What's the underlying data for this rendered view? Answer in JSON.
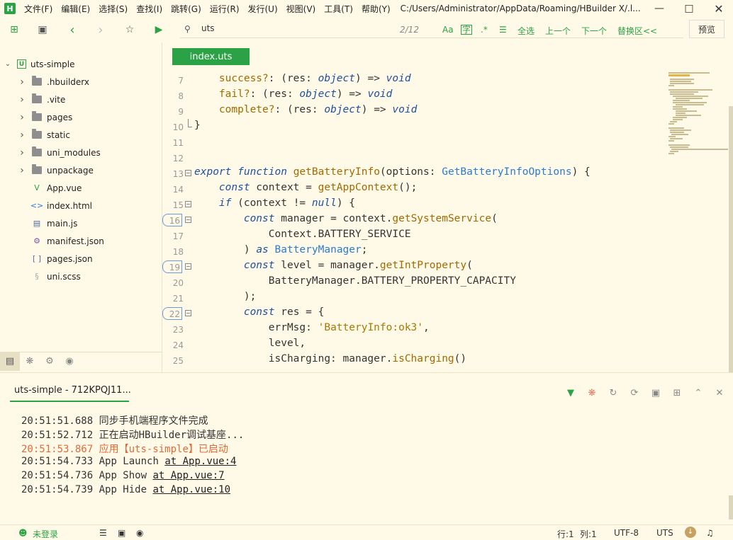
{
  "menubar": {
    "logo": "H",
    "items": [
      "文件(F)",
      "编辑(E)",
      "选择(S)",
      "查找(I)",
      "跳转(G)",
      "运行(R)",
      "发行(U)",
      "视图(V)",
      "工具(T)",
      "帮助(Y)"
    ],
    "path": "C:/Users/Administrator/AppData/Roaming/HBuilder X/.l..."
  },
  "toolbar": {
    "search_value": "uts",
    "match_count": "2/12",
    "select_all": "全选",
    "prev": "上一个",
    "next": "下一个",
    "replace": "替换区<<",
    "preview": "预览",
    "case_label": "Aa",
    "word_label": "字",
    "regex_label": ".*"
  },
  "sidebar": {
    "project": "uts-simple",
    "items": [
      {
        "label": ".hbuilderx",
        "type": "folder"
      },
      {
        "label": ".vite",
        "type": "folder"
      },
      {
        "label": "pages",
        "type": "folder"
      },
      {
        "label": "static",
        "type": "folder"
      },
      {
        "label": "uni_modules",
        "type": "folder"
      },
      {
        "label": "unpackage",
        "type": "folder"
      },
      {
        "label": "App.vue",
        "type": "vue",
        "icon": "V"
      },
      {
        "label": "index.html",
        "type": "html",
        "icon": "<>"
      },
      {
        "label": "main.js",
        "type": "js",
        "icon": "▤"
      },
      {
        "label": "manifest.json",
        "type": "json",
        "icon": "⚙"
      },
      {
        "label": "pages.json",
        "type": "json",
        "icon": "[ ]"
      },
      {
        "label": "uni.scss",
        "type": "scss",
        "icon": "§"
      }
    ]
  },
  "editor": {
    "tab": "index.uts",
    "lines": [
      {
        "n": "7",
        "fold": false,
        "boxed": false,
        "segs": [
          [
            "pl",
            "    "
          ],
          [
            "pr",
            "success?"
          ],
          [
            "pl",
            ": (res: "
          ],
          [
            "kw",
            "object"
          ],
          [
            "pl",
            ") "
          ],
          [
            "pl",
            "=> "
          ],
          [
            "kw",
            "void"
          ]
        ]
      },
      {
        "n": "8",
        "fold": false,
        "boxed": false,
        "segs": [
          [
            "pl",
            "    "
          ],
          [
            "pr",
            "fail?"
          ],
          [
            "pl",
            ": (res: "
          ],
          [
            "kw",
            "object"
          ],
          [
            "pl",
            ") => "
          ],
          [
            "kw",
            "void"
          ]
        ]
      },
      {
        "n": "9",
        "fold": false,
        "boxed": false,
        "segs": [
          [
            "pl",
            "    "
          ],
          [
            "pr",
            "complete?"
          ],
          [
            "pl",
            ": (res: "
          ],
          [
            "kw",
            "object"
          ],
          [
            "pl",
            ") => "
          ],
          [
            "kw",
            "void"
          ]
        ]
      },
      {
        "n": "10",
        "fold": false,
        "boxed": false,
        "segs": [
          [
            "pl",
            "}"
          ]
        ]
      },
      {
        "n": "11",
        "fold": false,
        "boxed": false,
        "segs": [
          [
            "pl",
            ""
          ]
        ]
      },
      {
        "n": "12",
        "fold": false,
        "boxed": false,
        "segs": [
          [
            "pl",
            ""
          ]
        ]
      },
      {
        "n": "13",
        "fold": true,
        "boxed": false,
        "segs": [
          [
            "kw",
            "export"
          ],
          [
            "pl",
            " "
          ],
          [
            "kw",
            "function"
          ],
          [
            "pl",
            " "
          ],
          [
            "fn",
            "getBatteryInfo"
          ],
          [
            "pl",
            "(options: "
          ],
          [
            "ty",
            "GetBatteryInfoOptions"
          ],
          [
            "pl",
            ") {"
          ]
        ]
      },
      {
        "n": "14",
        "fold": false,
        "boxed": false,
        "segs": [
          [
            "pl",
            "    "
          ],
          [
            "kw",
            "const"
          ],
          [
            "pl",
            " context = "
          ],
          [
            "fn",
            "getAppContext"
          ],
          [
            "pl",
            "();"
          ]
        ]
      },
      {
        "n": "15",
        "fold": true,
        "boxed": false,
        "segs": [
          [
            "pl",
            "    "
          ],
          [
            "kw",
            "if"
          ],
          [
            "pl",
            " (context != "
          ],
          [
            "kw",
            "null"
          ],
          [
            "pl",
            ") {"
          ]
        ]
      },
      {
        "n": "16",
        "fold": true,
        "boxed": true,
        "segs": [
          [
            "pl",
            "        "
          ],
          [
            "kw",
            "const"
          ],
          [
            "pl",
            " manager = context."
          ],
          [
            "fn",
            "getSystemService"
          ],
          [
            "pl",
            "("
          ]
        ]
      },
      {
        "n": "17",
        "fold": false,
        "boxed": false,
        "segs": [
          [
            "pl",
            "            Context.BATTERY_SERVICE"
          ]
        ]
      },
      {
        "n": "18",
        "fold": false,
        "boxed": false,
        "segs": [
          [
            "pl",
            "        ) "
          ],
          [
            "kw",
            "as"
          ],
          [
            "pl",
            " "
          ],
          [
            "ty",
            "BatteryManager"
          ],
          [
            "pl",
            ";"
          ]
        ]
      },
      {
        "n": "19",
        "fold": true,
        "boxed": true,
        "segs": [
          [
            "pl",
            "        "
          ],
          [
            "kw",
            "const"
          ],
          [
            "pl",
            " level = manager."
          ],
          [
            "fn",
            "getIntProperty"
          ],
          [
            "pl",
            "("
          ]
        ]
      },
      {
        "n": "20",
        "fold": false,
        "boxed": false,
        "segs": [
          [
            "pl",
            "            BatteryManager.BATTERY_PROPERTY_CAPACITY"
          ]
        ]
      },
      {
        "n": "21",
        "fold": false,
        "boxed": false,
        "segs": [
          [
            "pl",
            "        );"
          ]
        ]
      },
      {
        "n": "22",
        "fold": true,
        "boxed": true,
        "segs": [
          [
            "pl",
            "        "
          ],
          [
            "kw",
            "const"
          ],
          [
            "pl",
            " res = {"
          ]
        ]
      },
      {
        "n": "23",
        "fold": false,
        "boxed": false,
        "segs": [
          [
            "pl",
            "            errMsg: "
          ],
          [
            "str",
            "'BatteryInfo:ok3'"
          ],
          [
            "pl",
            ","
          ]
        ]
      },
      {
        "n": "24",
        "fold": false,
        "boxed": false,
        "segs": [
          [
            "pl",
            "            level,"
          ]
        ]
      },
      {
        "n": "25",
        "fold": false,
        "boxed": false,
        "segs": [
          [
            "pl",
            "            isCharging: manager."
          ],
          [
            "fn",
            "isCharging"
          ],
          [
            "pl",
            "()"
          ]
        ]
      }
    ]
  },
  "console": {
    "tab": "uts-simple - 712KPQJ11...",
    "logs": [
      {
        "time": "20:51:51.688",
        "msg": "同步手机端程序文件完成",
        "warn": false,
        "link": ""
      },
      {
        "time": "20:51:52.712",
        "msg": "正在启动HBuilder调试基座...",
        "warn": false,
        "link": ""
      },
      {
        "time": "20:51:53.867",
        "msg": "应用【uts-simple】已启动",
        "warn": true,
        "link": ""
      },
      {
        "time": "20:51:54.733",
        "msg": "App Launch ",
        "warn": false,
        "link": "at App.vue:4"
      },
      {
        "time": "20:51:54.736",
        "msg": "App Show ",
        "warn": false,
        "link": "at App.vue:7"
      },
      {
        "time": "20:51:54.739",
        "msg": "App Hide ",
        "warn": false,
        "link": "at App.vue:10"
      }
    ]
  },
  "statusbar": {
    "login": "未登录",
    "row": "行:1",
    "col": "列:1",
    "encoding": "UTF-8",
    "language": "UTS"
  },
  "colors": {
    "accent": "#2ba245",
    "background": "#fffae8",
    "keyword": "#1e50a2",
    "function": "#a06a00",
    "type": "#2a7bd4",
    "warning": "#e06a3a"
  }
}
